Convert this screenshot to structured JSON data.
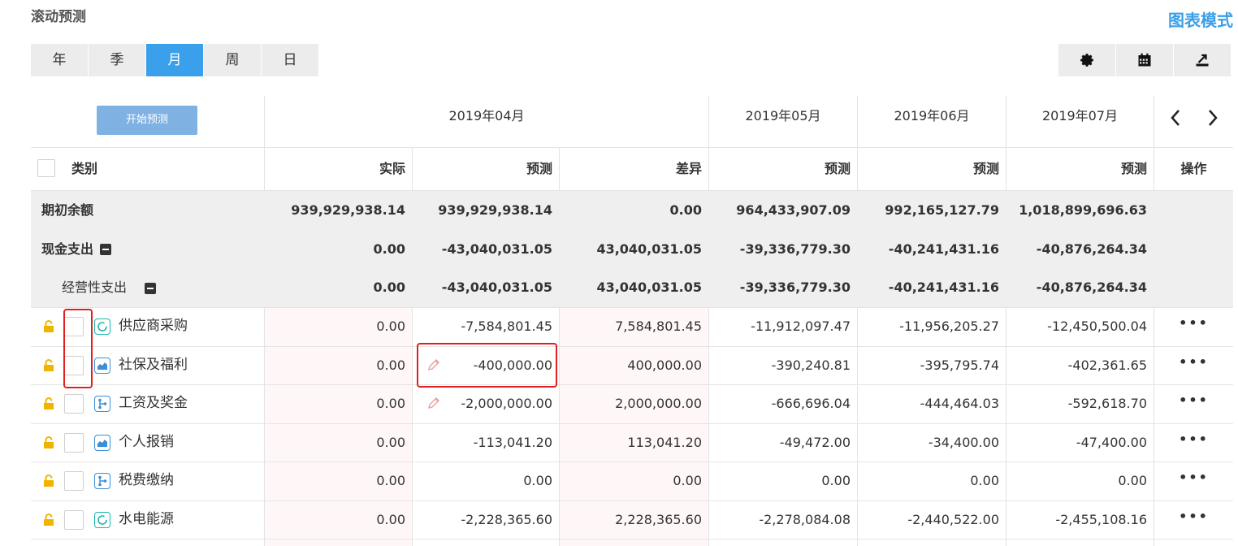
{
  "page": {
    "title": "滚动预测",
    "chart_mode": "图表模式"
  },
  "tabs": [
    "年",
    "季",
    "月",
    "周",
    "日"
  ],
  "active_tab": 2,
  "toolbar": {
    "icons": [
      "gear-icon",
      "calendar-icon",
      "export-icon"
    ]
  },
  "table": {
    "start_button": "开始预测",
    "category_header": "类别",
    "months": [
      "2019年04月",
      "2019年05月",
      "2019年06月",
      "2019年07月"
    ],
    "sub_headers": [
      "实际",
      "预测",
      "差异",
      "预测",
      "预测",
      "预测"
    ],
    "ops_header": "操作",
    "summary_rows": [
      {
        "label": "期初余额",
        "values": [
          "939,929,938.14",
          "939,929,938.14",
          "0.00",
          "964,433,907.09",
          "992,165,127.79",
          "1,018,899,696.63"
        ]
      },
      {
        "label": "现金支出",
        "values": [
          "0.00",
          "-43,040,031.05",
          "43,040,031.05",
          "-39,336,779.30",
          "-40,241,431.16",
          "-40,876,264.34"
        ]
      },
      {
        "label": "经营性支出",
        "values": [
          "0.00",
          "-43,040,031.05",
          "43,040,031.05",
          "-39,336,779.30",
          "-40,241,431.16",
          "-40,876,264.34"
        ]
      }
    ],
    "item_rows": [
      {
        "label": "供应商采购",
        "icon": "circle-icon",
        "values": [
          "0.00",
          "-7,584,801.45",
          "7,584,801.45",
          "-11,912,097.47",
          "-11,956,205.27",
          "-12,450,500.04"
        ],
        "more": "•••"
      },
      {
        "label": "社保及福利",
        "icon": "area-chart-icon",
        "values": [
          "0.00",
          "-400,000.00",
          "400,000.00",
          "-390,240.81",
          "-395,795.74",
          "-402,361.65"
        ],
        "more": "•••"
      },
      {
        "label": "工资及奖金",
        "icon": "branch-icon",
        "values": [
          "0.00",
          "-2,000,000.00",
          "2,000,000.00",
          "-666,696.04",
          "-444,464.03",
          "-592,618.70"
        ],
        "more": "•••"
      },
      {
        "label": "个人报销",
        "icon": "area-chart-icon",
        "values": [
          "0.00",
          "-113,041.20",
          "113,041.20",
          "-49,472.00",
          "-34,400.00",
          "-47,400.00"
        ],
        "more": "•••"
      },
      {
        "label": "税费缴纳",
        "icon": "branch-icon",
        "values": [
          "0.00",
          "0.00",
          "0.00",
          "0.00",
          "0.00",
          "0.00"
        ],
        "more": "•••"
      },
      {
        "label": "水电能源",
        "icon": "circle-icon",
        "values": [
          "0.00",
          "-2,228,365.60",
          "2,228,365.60",
          "-2,278,084.08",
          "-2,440,522.00",
          "-2,455,108.16"
        ],
        "more": "•••"
      }
    ]
  },
  "colors": {
    "accent": "#3aa0eb",
    "lock": "#f0b400",
    "teal": "#19b5b1",
    "blue": "#3a8fd6",
    "highlight": "#e02020"
  }
}
